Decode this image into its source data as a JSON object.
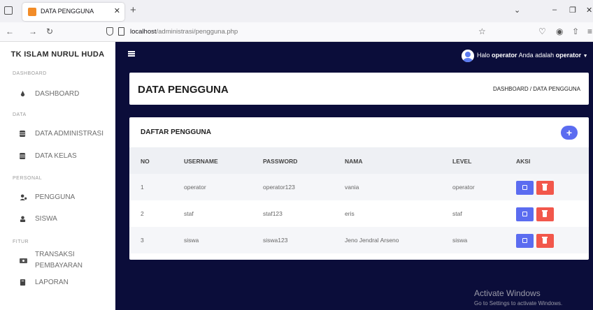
{
  "browser": {
    "tab_title": "DATA PENGGUNA",
    "url_host": "localhost",
    "url_path": "/administrasi/pengguna.php"
  },
  "sidebar": {
    "brand": "TK ISLAM NURUL HUDA",
    "sections": [
      {
        "label": "DASHBOARD",
        "items": [
          {
            "label": "DASHBOARD",
            "icon": "dashboard-icon"
          }
        ]
      },
      {
        "label": "DATA",
        "items": [
          {
            "label": "DATA ADMINISTRASI",
            "icon": "database-icon"
          },
          {
            "label": "DATA KELAS",
            "icon": "database-icon"
          }
        ]
      },
      {
        "label": "PERSONAL",
        "items": [
          {
            "label": "PENGGUNA",
            "icon": "user-gear-icon"
          },
          {
            "label": "SISWA",
            "icon": "user-icon"
          }
        ]
      },
      {
        "label": "FITUR",
        "items": [
          {
            "label": "TRANSAKSI",
            "label2": "PEMBAYARAN",
            "icon": "money-icon"
          },
          {
            "label": "LAPORAN",
            "icon": "book-icon"
          }
        ]
      }
    ]
  },
  "topbar": {
    "greet_prefix": "Halo",
    "username": "operator",
    "greet_mid": "Anda adalah",
    "role": "operator"
  },
  "header": {
    "title": "DATA PENGGUNA",
    "breadcrumb": "DASHBOARD  /  DATA PENGGUNA"
  },
  "table": {
    "title": "DAFTAR PENGGUNA",
    "add_label": "+",
    "columns": [
      "NO",
      "USERNAME",
      "PASSWORD",
      "NAMA",
      "LEVEL",
      "AKSI"
    ],
    "rows": [
      {
        "no": "1",
        "username": "operator",
        "password": "operator123",
        "nama": "vania",
        "level": "operator"
      },
      {
        "no": "2",
        "username": "staf",
        "password": "staf123",
        "nama": "eris",
        "level": "staf"
      },
      {
        "no": "3",
        "username": "siswa",
        "password": "siswa123",
        "nama": "Jeno Jendral Arseno",
        "level": "siswa"
      }
    ]
  },
  "watermark": {
    "line1": "Activate Windows",
    "line2": "Go to Settings to activate Windows."
  },
  "colors": {
    "sidebar_bg": "#ffffff",
    "topbar_bg": "#0b0d3a",
    "primary": "#5b6cf0",
    "danger": "#f2574b"
  }
}
